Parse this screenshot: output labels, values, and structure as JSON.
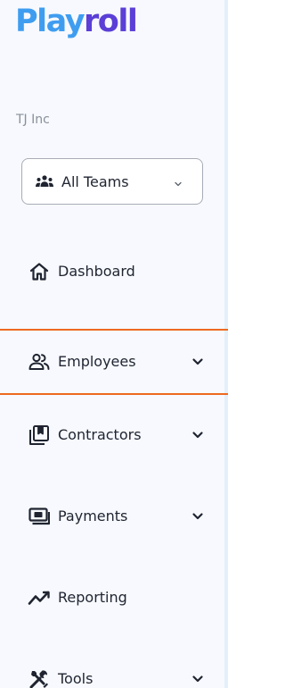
{
  "brand": {
    "logo_part1": "Play",
    "logo_part2": "roll"
  },
  "org": {
    "name": "TJ Inc"
  },
  "team_selector": {
    "label": "All Teams",
    "icon": "team-icon"
  },
  "nav": {
    "items": [
      {
        "label": "Dashboard",
        "icon": "home-icon",
        "expandable": false,
        "active": false
      },
      {
        "label": "Employees",
        "icon": "people-icon",
        "expandable": true,
        "active": true
      },
      {
        "label": "Contractors",
        "icon": "contractors-icon",
        "expandable": true,
        "active": false
      },
      {
        "label": "Payments",
        "icon": "payments-icon",
        "expandable": true,
        "active": false
      },
      {
        "label": "Reporting",
        "icon": "trend-icon",
        "expandable": false,
        "active": false
      },
      {
        "label": "Tools",
        "icon": "tools-icon",
        "expandable": true,
        "active": false
      }
    ]
  },
  "colors": {
    "logo_play": "#3f9df0",
    "logo_roll": "#5b3fd6",
    "active_border": "#ee6a1f",
    "sidebar_bg": "#f7f9fe"
  }
}
